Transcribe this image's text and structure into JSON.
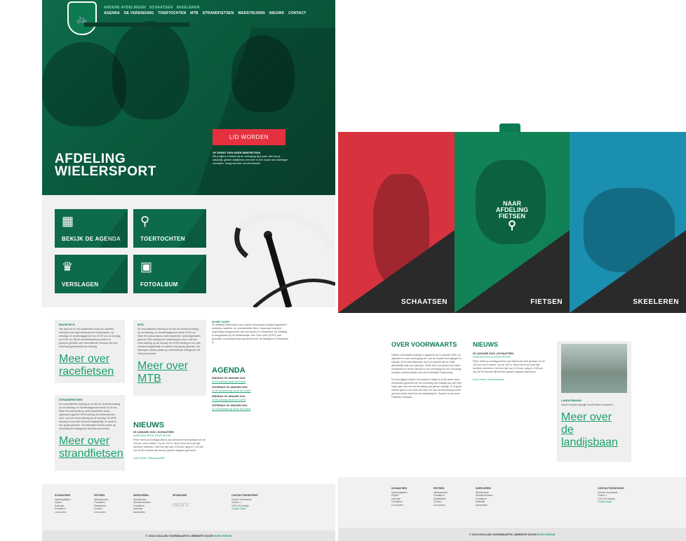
{
  "left": {
    "nav_upper": [
      "ANDERE AFDELINGEN",
      "SCHAATSEN",
      "SKEELEREN"
    ],
    "nav_lower": [
      "AGENDA",
      "DE VERENIGING",
      "TOERTOCHTEN",
      "MTB",
      "STRANDFIETSEN",
      "WEDSTRIJDEN",
      "NIEUWS",
      "CONTACT"
    ],
    "crest_icon": "bike-icon",
    "hero_title_1": "AFDELING",
    "hero_title_2": "WIELERSPORT",
    "lid_button": "LID WORDEN",
    "lid_heading": "OF EERST EEN KEER MEEFIETSEN",
    "lid_text": "Wil je kijken of fietsen bij de vereniging bij je past, dan kan je natuurlijk, geheel vrijblijvend, een keer in een mooie race-trainingen meerijden. Vraag wel even via dit formulier.",
    "tiles": [
      {
        "label": "BEKIJK DE AGENDA",
        "icon": "calendar-icon",
        "glyph": "📅"
      },
      {
        "label": "TOERTOCHTEN",
        "icon": "bike-icon",
        "glyph": "🚲"
      },
      {
        "label": "VERSLAGEN",
        "icon": "trophy-icon",
        "glyph": "🏆"
      },
      {
        "label": "FOTOALBUM",
        "icon": "photo-icon",
        "glyph": "🖼"
      }
    ],
    "racefiets": {
      "title": "RACEFIETS",
      "text": "Van april tot en met september wordt de racefiets training in de regel tweemaal per week plaats, op dinsdag- en donderdagavond om 19.00 uur, en zondag om 9.00 uur. Bij de racefietstraining wordt er in groepen gereden van verschillende niveaus met een maximaal gemiddelde per training.",
      "link": "Meer over racefietsen"
    },
    "strandfietsen": {
      "title": "STRANDFIETSEN",
      "text": "De mountainbike training is net als de racefiets training op de dinsdag- en donderdagavond vanaf 19.00 uur. Maar het seizoensloos vindt september wordt afgesloten gaat de MTB training het winterseizoen door, met een extra training op de zondag. De MTB training is voor alle niveaus toegankelijk, er wordt in een groep gereden. De trainingen vinden plaats op verschillende uitdagende off-road parcoursen.",
      "link": "Meer over strandfietsen"
    },
    "mtb": {
      "title": "MTB",
      "text": "De mountainbike training is net als de racefiets training op de dinsdag- en donderdagavond vanaf 19.00 uur. Maar het seizoensloos vindt september wordt afgesloten gaat de MTB training het winterseizoen door, met een extra training op de zondag. De MTB training is voor alle niveaus toegankelijk, er wordt in een groep gereden. De trainingen vinden plaats op verschillende uitdagende off-road parcoursen.",
      "link": "Meer over MTB"
    },
    "in_het_kort": {
      "title": "IN HET KORT",
      "text": "De afdeling Wielersport van Lisclub Voorwaarts Katwijk organiseert wekelijks racefiets- en mountainbike ritten. Daarnaast wordt er regelmatig deelgenomen aan toertochten in Nederland. De Afdeling is aangesloten bij de Nederlandse Toer Fiets Unie (NTFU) wat geschikte overkoepelende sportbond voor de fietssport in Nederland is."
    },
    "nieuws": {
      "title": "NIEUWS",
      "date": "05 JANUARI 2016 | SCHAATSEN",
      "headline": "ASSEGON-PRIJS VOOR PETER",
      "text": "Peter heeft op zondagochtend zijn sterkende best gedaan om de 100 p/s vol te maken. Op de 100 m. Word eerst de oude tijd lachtrich verbeterd. Met een tijd van 13.31sec. ging er 0,08 sec. van af! De tweede tijd werden grotere stappen gemonen.",
      "links": "Lees verder | Nieuwsarchief"
    },
    "agenda": {
      "title": "AGENDA",
      "items": [
        {
          "date": "DINSDAG 05 JANUARI 2016",
          "text": "19:00 training vanaf de Goerie"
        },
        {
          "date": "ZATERDAG 09 JANUARI 2016",
          "text": "11:00 Duintraining vanaf de Goerie"
        },
        {
          "date": "DINSDAG 05 JANUARI 2016",
          "text": "19:00 training vanaf de Goerie"
        },
        {
          "date": "ZATERDAG 09 JANUARI 2016",
          "text": "11:00 Duintraining vanaf de Goerie"
        }
      ]
    },
    "footer": {
      "cols": [
        {
          "title": "SCHAATSEN",
          "items": [
            "Openingstijden",
            "Prijzen",
            "Kalender",
            "Fotoalbum",
            "Lid worden"
          ]
        },
        {
          "title": "FIETSEN",
          "items": [
            "Wielersporda",
            "Fotoalbum",
            "Statistieken",
            "Contact",
            "Lid worden"
          ]
        },
        {
          "title": "SKEELEREN",
          "items": [
            "Skeelerbaan",
            "Skeelerverhalen",
            "Fotoalbum",
            "Kalender",
            "Aanmelden"
          ]
        },
        {
          "title": "SPONSORS",
          "items": []
        },
        {
          "title": "CONTACTGEGEVENS",
          "items": [
            "IJsclub Voorwaarts",
            "Goerie 1",
            "2221 ZH Katwijk",
            "Google Maps"
          ]
        }
      ],
      "sponsor_logo": "nico's",
      "copyright": "© 2016 IJSCLUB VOORWAARTS | WEBSITE DOOR",
      "credit": "BURO BROM"
    }
  },
  "right": {
    "crest_icon": "bike-icon",
    "panels": [
      {
        "label": "SCHAATSEN"
      },
      {
        "label": "FIETSEN"
      },
      {
        "label": "SKEELEREN"
      }
    ],
    "naar_1": "NAAR",
    "naar_2": "AFDELING",
    "naar_3": "FIETSEN",
    "naar_icon": "bike-icon",
    "over": {
      "title": "OVER VOORWAARTS",
      "p1": "IJsclub Voorwaarts Katwijk is opgericht op 13 januari 1893, en daarmee is onze vereniging één van de oudste verenigingen in Katwijk. Dit is heel bijzonder voor een ijsclub die tot 1986 afhankelijk was van natuurijs. Sinds het is de ijsclub zich sterk ontwikkeld en mede hierdoor is de vereniging bij het 150-jarige bestaan onderscheiden met de Koninklijke Erepenning.",
      "p2": "De vereniging IJsclub Voorwaarts Katwijk is al die jaren nauw verbonden geweest met de bevolking van Katwijk aan den Rijn maar later ook met de bevolking van geheel Katwijk. Er is geen enkele sport in ons land die aan zo'n oud al-aauwelang zoveel gezond verker bleek als de schaatssport. IJssport is een pure Hollands vermaak."
    },
    "nieuws": {
      "title": "NIEUWS",
      "date": "05 JANUARI 2016 | SCHAATSEN",
      "headline": "ASSEGON-PRIJS VOOR PETER",
      "text": "Peter heeft op zondagochtend zijn sterkende best gedaan om de 100 p/s vol te maken. Op de 100 m. Word eerst de oude tijd lachtrich verbeterd. Met een tijd van 13.31sec. ging er 0,08 sec. van af! De tweede tijd werden grotere stappen gemonen.",
      "links": "Lees verder | Nieuwsarchief"
    },
    "landijsbaan": {
      "title": "LANDIJSBAAN",
      "text": "Vanaf complex ijspalijs wordt bekke schaatsen",
      "link": "Meer over de landijsbaan"
    },
    "footer": {
      "cols": [
        {
          "title": "SCHAATSEN",
          "items": [
            "Openingstijden",
            "Prijzen",
            "Kalender",
            "Fotoalbum",
            "Lid worden"
          ]
        },
        {
          "title": "FIETSEN",
          "items": [
            "Wielersporda",
            "Fotoalbum",
            "Statistieken",
            "Contact",
            "Lid worden"
          ]
        },
        {
          "title": "SKEELEREN",
          "items": [
            "Skeelerbaan",
            "Skeelerverhalen",
            "Fotoalbum",
            "Kalender",
            "Aanmelden"
          ]
        },
        {
          "title": "CONTACTGEGEVENS",
          "items": [
            "IJsclub Voorwaarts",
            "Goerie 1",
            "2221 ZH Katwijk",
            "Google Maps"
          ]
        }
      ],
      "copyright": "© 2016 IJSCLUB VOORWAARTS | WEBSITE DOOR",
      "credit": "BURO BROM"
    }
  }
}
